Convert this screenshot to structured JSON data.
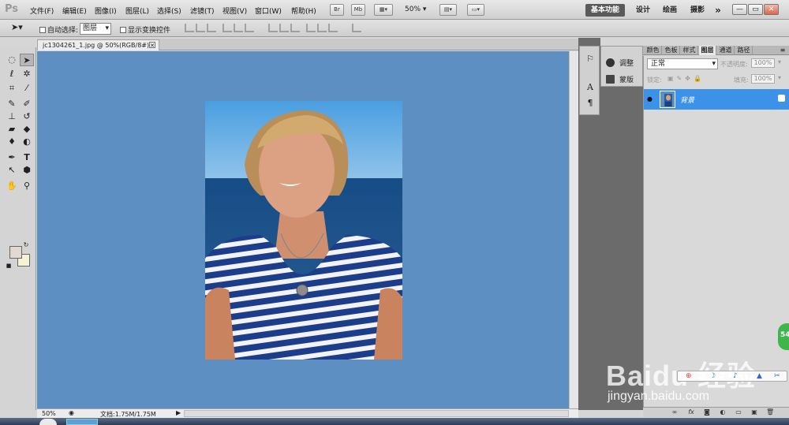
{
  "app": {
    "logo": "Ps",
    "menu": [
      "文件(F)",
      "编辑(E)",
      "图像(I)",
      "图层(L)",
      "选择(S)",
      "滤镜(T)",
      "视图(V)",
      "窗口(W)",
      "帮助(H)"
    ],
    "launch_bridge": "Br",
    "launch_minibridge": "Mb",
    "zoom_level": "50%",
    "workspaces": [
      "基本功能",
      "设计",
      "绘画",
      "摄影"
    ],
    "more_workspaces": "»",
    "window_controls": [
      "—",
      "▭",
      "✕"
    ]
  },
  "options_bar": {
    "auto_select_label": "自动选择:",
    "auto_select_target": "图层",
    "show_transform_label": "显示变换控件"
  },
  "tools": {
    "list": [
      "marquee",
      "move",
      "lasso",
      "quick-select",
      "crop",
      "eyedropper",
      "healing",
      "brush",
      "clone-stamp",
      "history-brush",
      "eraser",
      "paint-bucket",
      "blur",
      "dodge",
      "pen",
      "type",
      "path-select",
      "shape",
      "hand",
      "zoom"
    ]
  },
  "document": {
    "tab_title": "jc1304261_1.jpg @ 50%(RGB/8#)",
    "tab_close": "✕",
    "canvas_bg": "#5e8fc3"
  },
  "status": {
    "zoom": "50%",
    "doc_size": "文档:1.75M/1.75M"
  },
  "adjustments": {
    "rows": [
      "调整",
      "蒙版"
    ]
  },
  "panels": {
    "tabs": [
      "颜色",
      "色板",
      "样式",
      "图层",
      "通道",
      "路径"
    ],
    "active_tab": "图层",
    "blend_mode": "正常",
    "opacity_label": "不透明度:",
    "opacity_value": "100%",
    "lock_label": "锁定:",
    "fill_label": "填充:",
    "fill_value": "100%"
  },
  "layers": [
    {
      "name": "背景",
      "visible": true,
      "locked": true,
      "selected": true
    }
  ],
  "overlay": {
    "watermark_logo": "Baidu 经验",
    "watermark_url": "jingyan.baidu.com",
    "side_badge": "54"
  },
  "colors": {
    "layer_selected": "#3c92e9",
    "foreground": "#e1d9d1",
    "background": "#f7f1d6"
  }
}
